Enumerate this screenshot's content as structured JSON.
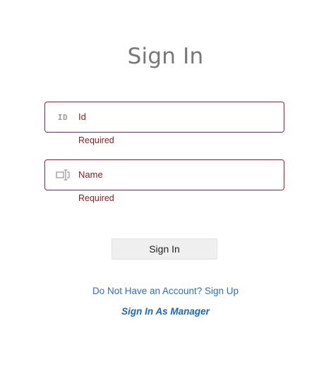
{
  "page": {
    "title": "Sign In"
  },
  "form": {
    "id_field": {
      "icon": "id-card-icon",
      "icon_text": "ID",
      "value": "Id",
      "error": "Required"
    },
    "name_field": {
      "icon": "text-cursor-icon",
      "value": "Name",
      "error": "Required"
    },
    "submit_label": "Sign In"
  },
  "links": {
    "signup": "Do Not Have an Account? Sign Up",
    "manager": "Sign In As Manager"
  },
  "colors": {
    "error": "#8b1a1a",
    "field_border": "#a4203a",
    "link": "#2c6fc0",
    "title": "#777777"
  }
}
